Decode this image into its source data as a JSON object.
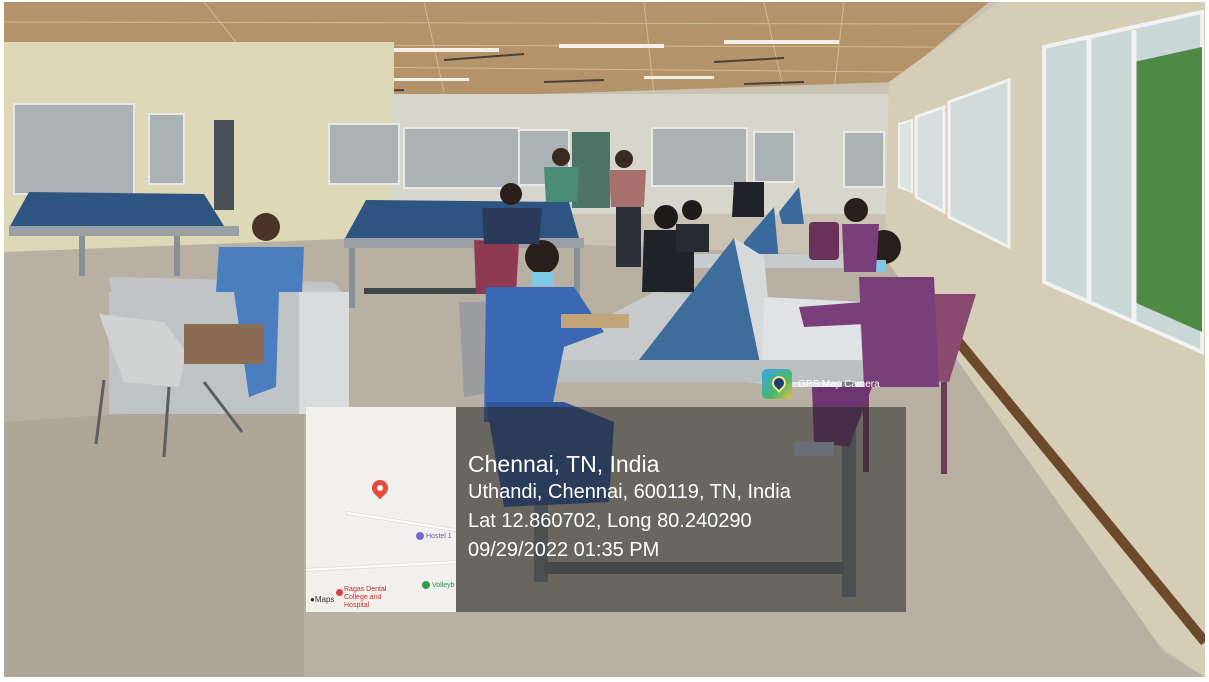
{
  "stamp": {
    "app_name": "GPS Map Camera",
    "city": "Chennai, TN, India",
    "address": "Uthandi, Chennai, 600119, TN, India",
    "coordinates": "Lat 12.860702, Long 80.240290",
    "datetime": "09/29/2022 01:35 PM"
  },
  "mini_map": {
    "brand": "Maps",
    "poi_hostel": "Hostel 1",
    "poi_volleyball": "Volleyb",
    "poi_dental_line1": "Ragas Dental",
    "poi_dental_line2": "College and",
    "poi_dental_line3": "Hospital",
    "pin_icon": "location-pin-icon"
  },
  "colors": {
    "pin": "#e64b3c",
    "desk_blue": "#3f6d9b",
    "scrubs_blue": "#3b68b5",
    "scrubs_purple": "#7a3f7a"
  }
}
